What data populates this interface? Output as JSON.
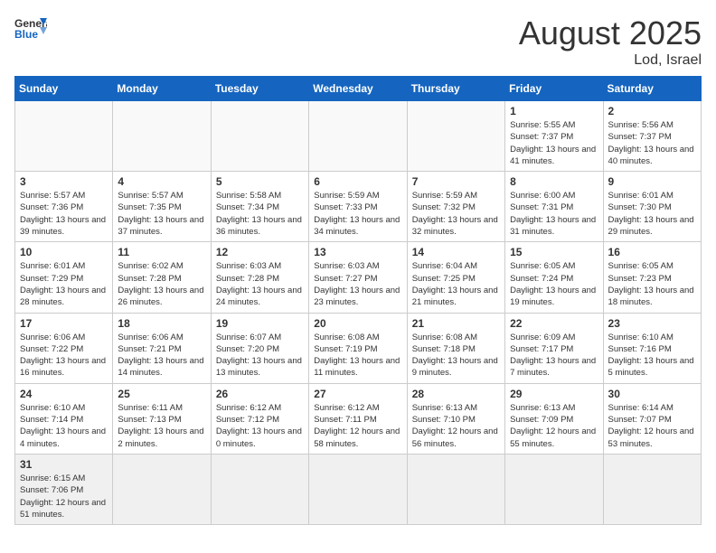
{
  "header": {
    "logo_general": "General",
    "logo_blue": "Blue",
    "title": "August 2025",
    "subtitle": "Lod, Israel"
  },
  "weekdays": [
    "Sunday",
    "Monday",
    "Tuesday",
    "Wednesday",
    "Thursday",
    "Friday",
    "Saturday"
  ],
  "weeks": [
    [
      {
        "day": "",
        "info": ""
      },
      {
        "day": "",
        "info": ""
      },
      {
        "day": "",
        "info": ""
      },
      {
        "day": "",
        "info": ""
      },
      {
        "day": "",
        "info": ""
      },
      {
        "day": "1",
        "info": "Sunrise: 5:55 AM\nSunset: 7:37 PM\nDaylight: 13 hours and 41 minutes."
      },
      {
        "day": "2",
        "info": "Sunrise: 5:56 AM\nSunset: 7:37 PM\nDaylight: 13 hours and 40 minutes."
      }
    ],
    [
      {
        "day": "3",
        "info": "Sunrise: 5:57 AM\nSunset: 7:36 PM\nDaylight: 13 hours and 39 minutes."
      },
      {
        "day": "4",
        "info": "Sunrise: 5:57 AM\nSunset: 7:35 PM\nDaylight: 13 hours and 37 minutes."
      },
      {
        "day": "5",
        "info": "Sunrise: 5:58 AM\nSunset: 7:34 PM\nDaylight: 13 hours and 36 minutes."
      },
      {
        "day": "6",
        "info": "Sunrise: 5:59 AM\nSunset: 7:33 PM\nDaylight: 13 hours and 34 minutes."
      },
      {
        "day": "7",
        "info": "Sunrise: 5:59 AM\nSunset: 7:32 PM\nDaylight: 13 hours and 32 minutes."
      },
      {
        "day": "8",
        "info": "Sunrise: 6:00 AM\nSunset: 7:31 PM\nDaylight: 13 hours and 31 minutes."
      },
      {
        "day": "9",
        "info": "Sunrise: 6:01 AM\nSunset: 7:30 PM\nDaylight: 13 hours and 29 minutes."
      }
    ],
    [
      {
        "day": "10",
        "info": "Sunrise: 6:01 AM\nSunset: 7:29 PM\nDaylight: 13 hours and 28 minutes."
      },
      {
        "day": "11",
        "info": "Sunrise: 6:02 AM\nSunset: 7:28 PM\nDaylight: 13 hours and 26 minutes."
      },
      {
        "day": "12",
        "info": "Sunrise: 6:03 AM\nSunset: 7:28 PM\nDaylight: 13 hours and 24 minutes."
      },
      {
        "day": "13",
        "info": "Sunrise: 6:03 AM\nSunset: 7:27 PM\nDaylight: 13 hours and 23 minutes."
      },
      {
        "day": "14",
        "info": "Sunrise: 6:04 AM\nSunset: 7:25 PM\nDaylight: 13 hours and 21 minutes."
      },
      {
        "day": "15",
        "info": "Sunrise: 6:05 AM\nSunset: 7:24 PM\nDaylight: 13 hours and 19 minutes."
      },
      {
        "day": "16",
        "info": "Sunrise: 6:05 AM\nSunset: 7:23 PM\nDaylight: 13 hours and 18 minutes."
      }
    ],
    [
      {
        "day": "17",
        "info": "Sunrise: 6:06 AM\nSunset: 7:22 PM\nDaylight: 13 hours and 16 minutes."
      },
      {
        "day": "18",
        "info": "Sunrise: 6:06 AM\nSunset: 7:21 PM\nDaylight: 13 hours and 14 minutes."
      },
      {
        "day": "19",
        "info": "Sunrise: 6:07 AM\nSunset: 7:20 PM\nDaylight: 13 hours and 13 minutes."
      },
      {
        "day": "20",
        "info": "Sunrise: 6:08 AM\nSunset: 7:19 PM\nDaylight: 13 hours and 11 minutes."
      },
      {
        "day": "21",
        "info": "Sunrise: 6:08 AM\nSunset: 7:18 PM\nDaylight: 13 hours and 9 minutes."
      },
      {
        "day": "22",
        "info": "Sunrise: 6:09 AM\nSunset: 7:17 PM\nDaylight: 13 hours and 7 minutes."
      },
      {
        "day": "23",
        "info": "Sunrise: 6:10 AM\nSunset: 7:16 PM\nDaylight: 13 hours and 5 minutes."
      }
    ],
    [
      {
        "day": "24",
        "info": "Sunrise: 6:10 AM\nSunset: 7:14 PM\nDaylight: 13 hours and 4 minutes."
      },
      {
        "day": "25",
        "info": "Sunrise: 6:11 AM\nSunset: 7:13 PM\nDaylight: 13 hours and 2 minutes."
      },
      {
        "day": "26",
        "info": "Sunrise: 6:12 AM\nSunset: 7:12 PM\nDaylight: 13 hours and 0 minutes."
      },
      {
        "day": "27",
        "info": "Sunrise: 6:12 AM\nSunset: 7:11 PM\nDaylight: 12 hours and 58 minutes."
      },
      {
        "day": "28",
        "info": "Sunrise: 6:13 AM\nSunset: 7:10 PM\nDaylight: 12 hours and 56 minutes."
      },
      {
        "day": "29",
        "info": "Sunrise: 6:13 AM\nSunset: 7:09 PM\nDaylight: 12 hours and 55 minutes."
      },
      {
        "day": "30",
        "info": "Sunrise: 6:14 AM\nSunset: 7:07 PM\nDaylight: 12 hours and 53 minutes."
      }
    ],
    [
      {
        "day": "31",
        "info": "Sunrise: 6:15 AM\nSunset: 7:06 PM\nDaylight: 12 hours and 51 minutes."
      },
      {
        "day": "",
        "info": ""
      },
      {
        "day": "",
        "info": ""
      },
      {
        "day": "",
        "info": ""
      },
      {
        "day": "",
        "info": ""
      },
      {
        "day": "",
        "info": ""
      },
      {
        "day": "",
        "info": ""
      }
    ]
  ]
}
